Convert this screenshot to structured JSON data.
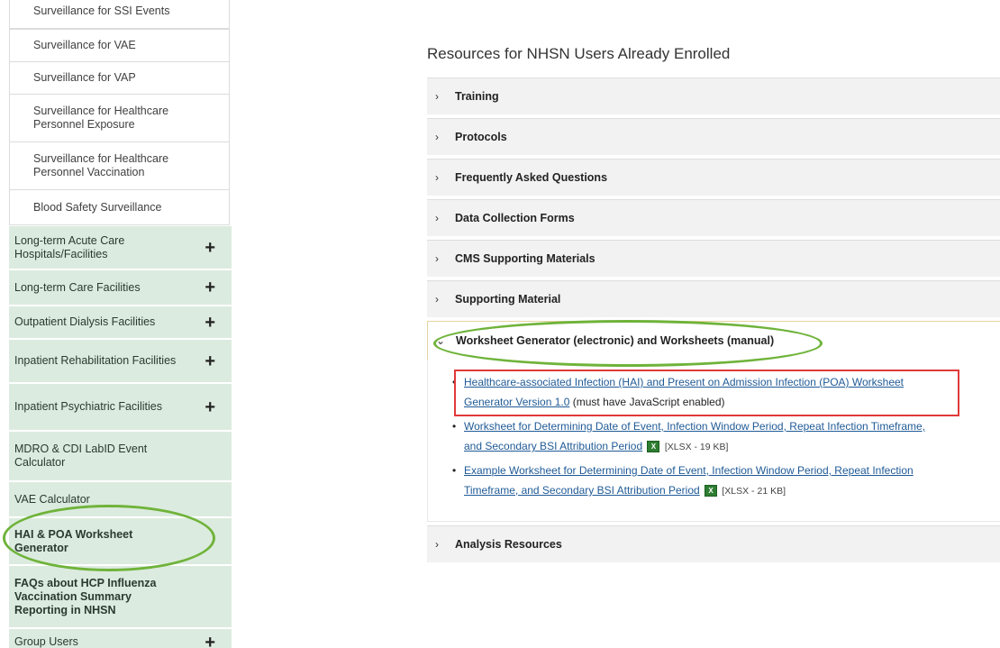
{
  "sidebar": {
    "cut_off_item": "Surveillance for SSI Events",
    "sub_items": [
      "Surveillance for VAE",
      "Surveillance for VAP",
      "Surveillance for Healthcare Personnel Exposure",
      "Surveillance for Healthcare Personnel Vaccination",
      "Blood Safety Surveillance"
    ],
    "main_items": [
      {
        "label": "Long-term Acute Care Hospitals/Facilities",
        "expand": "+"
      },
      {
        "label": "Long-term Care Facilities",
        "expand": "+"
      },
      {
        "label": "Outpatient Dialysis Facilities",
        "expand": "+"
      },
      {
        "label": "Inpatient Rehabilitation Facilities",
        "expand": "+"
      },
      {
        "label": "Inpatient Psychiatric Facilities",
        "expand": "+"
      },
      {
        "label": "MDRO & CDI LabID Event Calculator"
      },
      {
        "label": "VAE Calculator"
      },
      {
        "label": "HAI & POA Worksheet Generator"
      },
      {
        "label": "FAQs about HCP Influenza Vaccination Summary Reporting in NHSN"
      },
      {
        "label": "Group Users",
        "expand": "+"
      }
    ]
  },
  "content": {
    "title": "Resources for NHSN Users Already Enrolled",
    "accordion": [
      {
        "label": "Training",
        "chevron": "›"
      },
      {
        "label": "Protocols",
        "chevron": "›"
      },
      {
        "label": "Frequently Asked Questions",
        "chevron": "›"
      },
      {
        "label": "Data Collection Forms",
        "chevron": "›"
      },
      {
        "label": "CMS Supporting Materials",
        "chevron": "›"
      },
      {
        "label": "Supporting Material",
        "chevron": "›"
      },
      {
        "label": "Worksheet Generator (electronic) and Worksheets (manual)",
        "chevron": "⌄"
      },
      {
        "label": "Analysis Resources",
        "chevron": "›"
      }
    ],
    "links": [
      {
        "line1": "Healthcare-associated Infection (HAI) and Present on Admission Infection (POA) Worksheet",
        "line2": "Generator Version 1.0",
        "note": "(must have JavaScript enabled)"
      },
      {
        "line1": "Worksheet for Determining Date of Event, Infection Window Period, Repeat Infection Timeframe,",
        "line2": "and Secondary BSI Attribution Period",
        "meta": "[XLSX - 19 KB]",
        "icon": "excel-icon"
      },
      {
        "line1": "Example Worksheet for Determining Date of Event, Infection Window Period, Repeat Infection",
        "line2": "Timeframe, and Secondary BSI Attribution Period",
        "meta": "[XLSX - 21 KB]",
        "icon": "excel-icon"
      }
    ],
    "bullet": "•",
    "xls_glyph": "X"
  },
  "colors": {
    "sidebar_main_bg": "#dcebdf",
    "link": "#1f5a96",
    "highlight_red": "#e03a3a",
    "highlight_green": "#6fb33a"
  }
}
